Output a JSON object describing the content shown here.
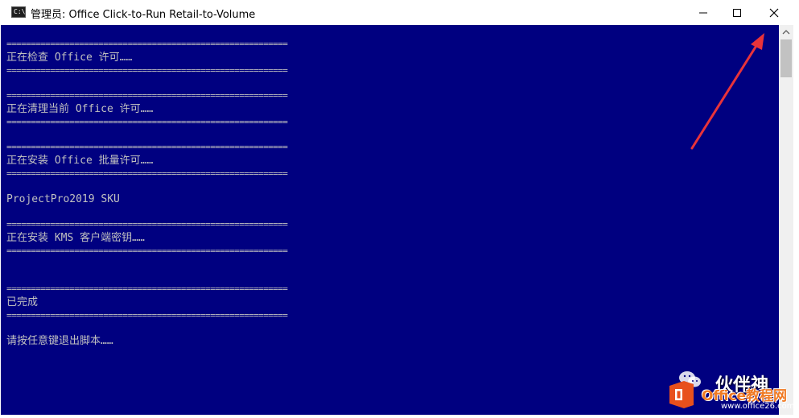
{
  "window": {
    "icon_label": "C:\\",
    "title": "管理员:  Office Click-to-Run Retail-to-Volume",
    "controls": [
      "minimize",
      "maximize",
      "close"
    ]
  },
  "console": {
    "lines": [
      "==========================================================",
      "正在检查 Office 许可……",
      "==========================================================",
      "==========================================================",
      "正在清理当前 Office 许可……",
      "==========================================================",
      "==========================================================",
      "正在安装 Office 批量许可……",
      "==========================================================",
      "ProjectPro2019 SKU",
      "==========================================================",
      "正在安装 KMS 客户端密钥……",
      "==========================================================",
      "==========================================================",
      "已完成",
      "==========================================================",
      "请按任意键退出脚本……"
    ]
  },
  "watermark": {
    "wechat_name": "伙伴神",
    "brand": "Office教程网",
    "url": "www.office26.com"
  },
  "colors": {
    "console_bg": "#000080",
    "console_text": "#c0c0c0",
    "arrow": "#e8333a",
    "brand_orange": "#f07a23"
  }
}
